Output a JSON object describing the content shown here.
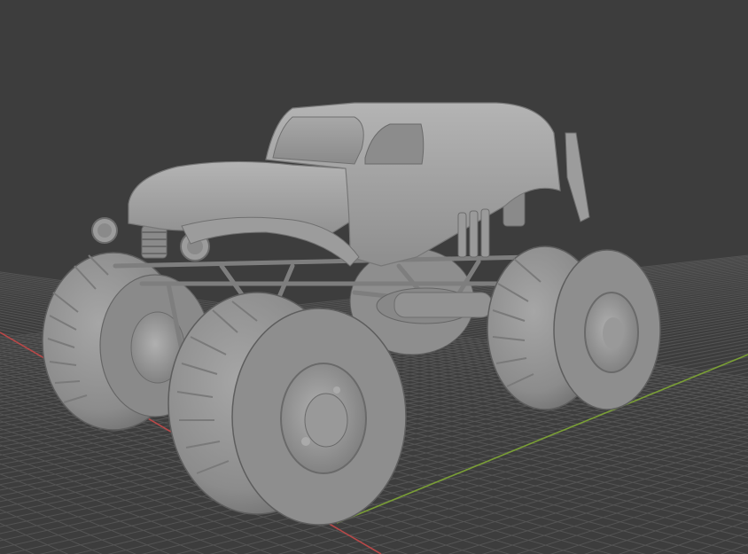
{
  "viewport": {
    "background": "#3d3d3d",
    "grid_color": "#545454",
    "x_axis_color": "#c24a4a",
    "y_axis_color": "#7fa33a",
    "model_base_color": "#9a9a9a",
    "model_shade_color": "#6e6e6e",
    "model_highlight_color": "#b9b9b9"
  },
  "scene": {
    "object": "monster-truck-model",
    "shading": "solid",
    "grid": true,
    "axes": [
      "x",
      "y"
    ]
  }
}
